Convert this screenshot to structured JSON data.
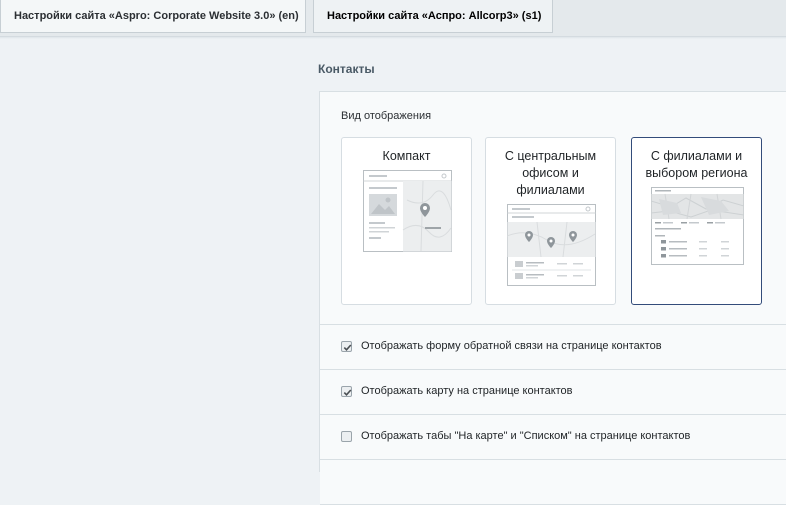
{
  "tabs": [
    {
      "label": "Настройки сайта «Aspro: Corporate Website 3.0» (en)"
    },
    {
      "label": "Настройки сайта «Аспро: Allcorp3» (s1)"
    }
  ],
  "section": {
    "title": "Контакты"
  },
  "display": {
    "label": "Вид отображения",
    "options": [
      {
        "title": "Компакт",
        "selected": false
      },
      {
        "title": "С центральным офисом и филиалами",
        "selected": false
      },
      {
        "title": "С филиалами и выбором региона",
        "selected": true
      }
    ]
  },
  "options": [
    {
      "label": "Отображать форму обратной связи на странице контактов",
      "checked": true
    },
    {
      "label": "Отображать карту на странице контактов",
      "checked": true
    },
    {
      "label": "Отображать табы \"На карте\" и \"Списком\" на странице контактов",
      "checked": false
    }
  ],
  "colors": {
    "accent": "#334c7a",
    "background": "#eef2f5",
    "panel": "#f8fafb"
  }
}
